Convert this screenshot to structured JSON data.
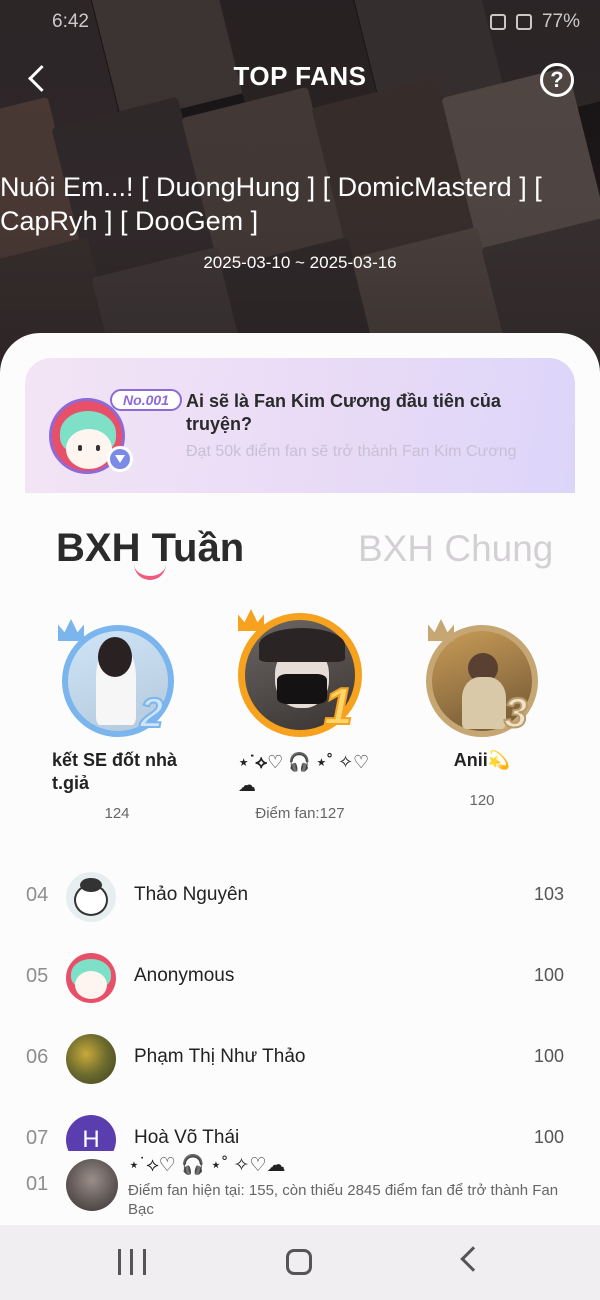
{
  "status_bar": {
    "time": "6:42",
    "battery": "77%"
  },
  "header": {
    "title": "TOP FANS",
    "story_title": "Nuôi Em...! [ DuongHung ] [ DomicMasterd ] [ CapRyh ] [ DooGem ]",
    "date_range": "2025-03-10 ~ 2025-03-16"
  },
  "promo": {
    "badge": "No.001",
    "headline": "Ai sẽ là Fan Kim Cương đầu tiên của truyện?",
    "subtext": "Đạt 50k điểm fan sẽ trở thành Fan Kim Cương"
  },
  "tabs": {
    "weekly": "BXH Tuần",
    "overall": "BXH Chung"
  },
  "podium": [
    {
      "rank": "2",
      "name": "kết SE đốt nhà t.giả",
      "score": "124",
      "ring_color": "#7ab5ee"
    },
    {
      "rank": "1",
      "name": "⋆˙⟡♡ 🎧 ⋆˚ ✧♡☁︎",
      "score": "Điểm fan:127",
      "ring_color": "#f6a21f"
    },
    {
      "rank": "3",
      "name": "Anii💫",
      "score": "120",
      "ring_color": "#c6a774"
    }
  ],
  "list": [
    {
      "rank": "04",
      "name": "Thảo Nguyên",
      "score": "103"
    },
    {
      "rank": "05",
      "name": "Anonymous",
      "score": "100"
    },
    {
      "rank": "06",
      "name": "Phạm Thị Như Thảo",
      "score": "100"
    },
    {
      "rank": "07",
      "name": "Hoà Võ Thái",
      "score": "100",
      "initial": "H"
    }
  ],
  "me": {
    "rank": "01",
    "name": "⋆˙⟡♡ 🎧 ⋆˚ ✧♡☁︎",
    "description": "Điểm fan hiện tại: 155, còn thiếu 2845 điểm fan để trở thành Fan Bạc"
  },
  "icons": {
    "back": "back-arrow-icon",
    "help": "help-circle-icon",
    "nav_recent": "recent-apps-icon",
    "nav_home": "home-icon",
    "nav_back": "nav-back-icon"
  },
  "colors": {
    "accent": "#f05a7e",
    "promo_accent": "#8e6ad8",
    "gold": "#f6a21f",
    "silver_blue": "#7ab5ee",
    "bronze": "#c6a774"
  }
}
